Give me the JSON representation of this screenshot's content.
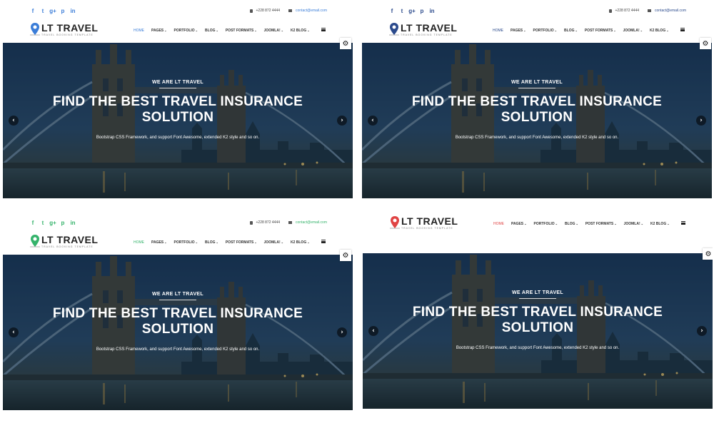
{
  "variants": [
    {
      "id": "blue",
      "accent": "#3b7dd8",
      "socials": [
        {
          "icon": "facebook-icon",
          "glyph": "f"
        },
        {
          "icon": "twitter-icon",
          "glyph": "t"
        },
        {
          "icon": "google-plus-icon",
          "glyph": "g+"
        },
        {
          "icon": "pinterest-icon",
          "glyph": "p"
        },
        {
          "icon": "linkedin-icon",
          "glyph": "in"
        }
      ],
      "phone": "+228 872 4444",
      "email": "contact@email.com"
    },
    {
      "id": "navy",
      "accent": "#2b4a8c",
      "phone": "+228 872 4444",
      "email": "contact@email.com"
    },
    {
      "id": "green",
      "accent": "#35b36b",
      "phone": "+228 872 4444",
      "email": "contact@email.com"
    },
    {
      "id": "red",
      "accent": "#e04444"
    }
  ],
  "logo": {
    "title": "LT TRAVEL",
    "tagline": "Travel Booking Template"
  },
  "menu": [
    "HOME",
    "PAGES",
    "PORTFOLIO",
    "BLOG",
    "POST FORMATS",
    "JOOMLA!",
    "K2 BLOG"
  ],
  "hero": {
    "kicker": "WE ARE LT TRAVEL",
    "title": "FIND THE BEST TRAVEL INSURANCE SOLUTION",
    "subtitle": "Bootstrap CSS Framework, and support Font Awesome, extended K2 style and so on."
  },
  "icons": {
    "prev": "‹",
    "next": "›",
    "gear": "⚙",
    "caret": "⌄"
  }
}
